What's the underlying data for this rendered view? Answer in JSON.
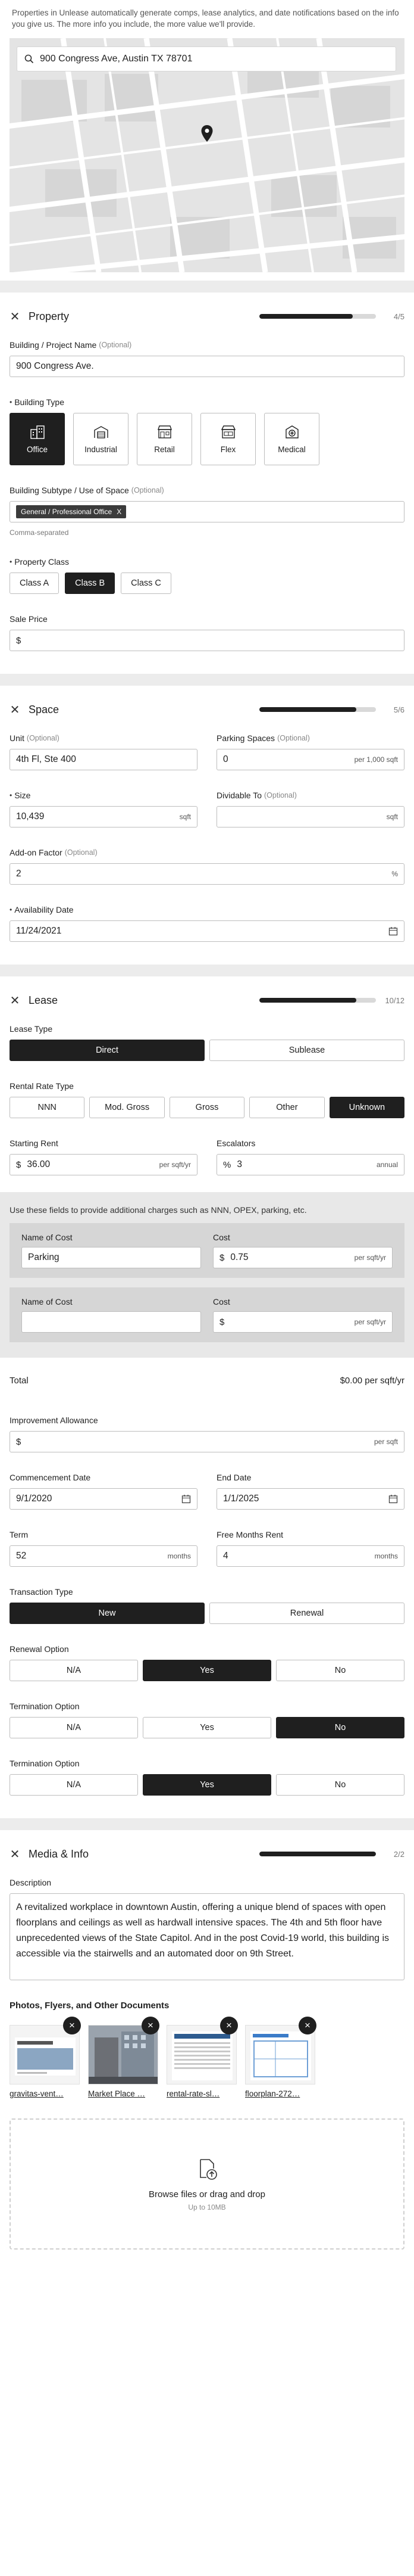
{
  "intro": "Properties in Unlease automatically generate comps, lease analytics, and date notifications based on the info you give us. The more info you include, the more value we'll provide.",
  "map": {
    "address": "900 Congress Ave, Austin TX 78701"
  },
  "property": {
    "title": "Property",
    "count": "4/5",
    "progress": 0.8,
    "name_label": "Building / Project Name",
    "name_opt": "(Optional)",
    "name_value": "900 Congress Ave.",
    "type_label": "Building Type",
    "types": [
      {
        "label": "Office",
        "icon": "office-building-icon",
        "selected": true
      },
      {
        "label": "Industrial",
        "icon": "warehouse-icon",
        "selected": false
      },
      {
        "label": "Retail",
        "icon": "storefront-icon",
        "selected": false
      },
      {
        "label": "Flex",
        "icon": "flex-space-icon",
        "selected": false
      },
      {
        "label": "Medical",
        "icon": "medical-cross-icon",
        "selected": false
      }
    ],
    "subtype_label": "Building Subtype / Use of Space",
    "subtype_opt": "(Optional)",
    "subtype_chip": "General / Professional Office",
    "chip_x": "X",
    "subtype_hint": "Comma-separated",
    "class_label": "Property Class",
    "classes": [
      {
        "label": "Class A",
        "selected": false
      },
      {
        "label": "Class B",
        "selected": true
      },
      {
        "label": "Class C",
        "selected": false
      }
    ],
    "price_label": "Sale Price",
    "price_prefix": "$"
  },
  "space": {
    "title": "Space",
    "count": "5/6",
    "progress": 0.833,
    "unit_label": "Unit",
    "unit_opt": "(Optional)",
    "unit_value": "4th Fl, Ste 400",
    "parking_label": "Parking Spaces",
    "parking_opt": "(Optional)",
    "parking_value": "0",
    "parking_unit": "per 1,000 sqft",
    "size_label": "Size",
    "size_value": "10,439",
    "size_unit": "sqft",
    "divide_label": "Dividable To",
    "divide_opt": "(Optional)",
    "divide_unit": "sqft",
    "addon_label": "Add-on Factor",
    "addon_opt": "(Optional)",
    "addon_value": "2",
    "addon_unit": "%",
    "avail_label": "Availability Date",
    "avail_value": "11/24/2021"
  },
  "lease": {
    "title": "Lease",
    "count": "10/12",
    "progress": 0.833,
    "type_label": "Lease Type",
    "types": [
      {
        "label": "Direct",
        "selected": true
      },
      {
        "label": "Sublease",
        "selected": false
      }
    ],
    "rate_label": "Rental Rate Type",
    "rates": [
      {
        "label": "NNN",
        "selected": false
      },
      {
        "label": "Mod. Gross",
        "selected": false
      },
      {
        "label": "Gross",
        "selected": false
      },
      {
        "label": "Other",
        "selected": false
      },
      {
        "label": "Unknown",
        "selected": true
      }
    ],
    "rent_label": "Starting Rent",
    "rent_prefix": "$",
    "rent_value": "36.00",
    "rent_unit": "per sqft/yr",
    "esc_label": "Escalators",
    "esc_prefix": "%",
    "esc_value": "3",
    "esc_unit": "annual",
    "costs_note": "Use these fields to provide additional charges such as NNN, OPEX, parking, etc.",
    "costs": [
      {
        "name_label": "Name of Cost",
        "name_value": "Parking",
        "cost_label": "Cost",
        "prefix": "$",
        "cost_value": "0.75",
        "unit": "per sqft/yr"
      },
      {
        "name_label": "Name of Cost",
        "name_value": "",
        "cost_label": "Cost",
        "prefix": "$",
        "cost_value": "",
        "unit": "per sqft/yr"
      }
    ],
    "total_label": "Total",
    "total_value": "$0.00 per sqft/yr",
    "ti_label": "Improvement Allowance",
    "ti_prefix": "$",
    "ti_unit": "per sqft",
    "comm_label": "Commencement Date",
    "comm_value": "9/1/2020",
    "end_label": "End Date",
    "end_value": "1/1/2025",
    "term_label": "Term",
    "term_value": "52",
    "term_unit": "months",
    "free_label": "Free Months Rent",
    "free_value": "4",
    "free_unit": "months",
    "trans_label": "Transaction Type",
    "trans": [
      {
        "label": "New",
        "selected": true
      },
      {
        "label": "Renewal",
        "selected": false
      }
    ],
    "renewal_label": "Renewal Option",
    "renewal": [
      {
        "label": "N/A",
        "selected": false
      },
      {
        "label": "Yes",
        "selected": true
      },
      {
        "label": "No",
        "selected": false
      }
    ],
    "term1_label": "Termination Option",
    "term1": [
      {
        "label": "N/A",
        "selected": false
      },
      {
        "label": "Yes",
        "selected": false
      },
      {
        "label": "No",
        "selected": true
      }
    ],
    "term2_label": "Termination Option",
    "term2": [
      {
        "label": "N/A",
        "selected": false
      },
      {
        "label": "Yes",
        "selected": true
      },
      {
        "label": "No",
        "selected": false
      }
    ]
  },
  "media": {
    "title": "Media & Info",
    "count": "2/2",
    "progress": 1.0,
    "desc_label": "Description",
    "desc_value": "A revitalized workplace in downtown Austin, offering a unique blend of spaces with open floorplans and ceilings as well as hardwall intensive spaces. The 4th and 5th floor have unprecedented views of the State Capitol. And in the post Covid-19 world, this building is accessible via the stairwells and an automated door on 9th Street.",
    "docs_title": "Photos, Flyers, and Other Documents",
    "docs": [
      {
        "name": "gravitas-vent…"
      },
      {
        "name": "Market Place …"
      },
      {
        "name": "rental-rate-sl…"
      },
      {
        "name": "floorplan-272…"
      }
    ],
    "doc_remove": "×",
    "drop_text": "Browse files or drag and drop",
    "drop_hint": "Up to 10MB"
  },
  "colors": {
    "primary": "#1f1f1f",
    "band": "#e8e8e8",
    "card": "#d6d6d6"
  }
}
